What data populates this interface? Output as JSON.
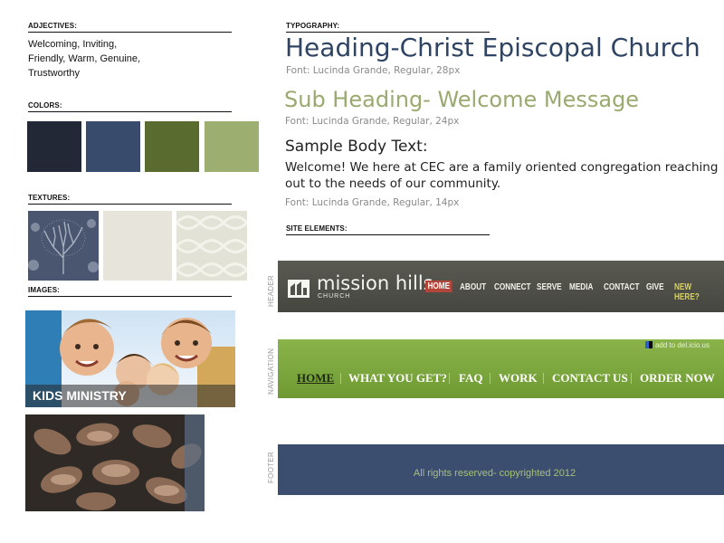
{
  "adjectives": {
    "label": "ADJECTIVES:",
    "line1": "Welcoming, Inviting,",
    "line2": "Friendly, Warm, Genuine,",
    "line3": "Trustworthy"
  },
  "colors": {
    "label": "COLORS:",
    "swatches": [
      "#232836",
      "#394b6d",
      "#5a6b2f",
      "#9daf70"
    ]
  },
  "textures": {
    "label": "TEXTURES:",
    "items": [
      "tree-pattern-texture",
      "plain-linen-texture",
      "lattice-pattern-texture"
    ]
  },
  "images": {
    "label": "IMAGES:",
    "kids_caption": "KIDS MINISTRY"
  },
  "typography": {
    "label": "TYPOGRAPHY:",
    "heading": "Heading-Christ Episcopal Church",
    "heading_note": "Font: Lucinda Grande, Regular, 28px",
    "subheading": "Sub Heading- Welcome Message",
    "subheading_note": "Font: Lucinda Grande, Regular, 24px",
    "body_title": "Sample Body Text:",
    "body_text": "Welcome! We here at CEC are a family oriented congregation reaching out to the needs of our community.",
    "body_note": "Font: Lucinda Grande, Regular, 14px"
  },
  "site_elements": {
    "label": "SITE ELEMENTS:",
    "header_label": "HEADER",
    "navigation_label": "NAVIGATION",
    "footer_label": "FOOTER",
    "header": {
      "logo_text": "mission hills",
      "logo_sub": "CHURCH",
      "nav": [
        "HOME",
        "ABOUT",
        "CONNECT",
        "SERVE",
        "MEDIA",
        "CONTACT",
        "GIVE",
        "NEW HERE?"
      ]
    },
    "navigation": {
      "delicious": "add to del.icio.us",
      "items": [
        "HOME",
        "WHAT YOU GET?",
        "FAQ",
        "WORK",
        "CONTACT US",
        "ORDER NOW"
      ]
    },
    "footer": {
      "text": "All rights reserved- copyrighted 2012"
    }
  }
}
